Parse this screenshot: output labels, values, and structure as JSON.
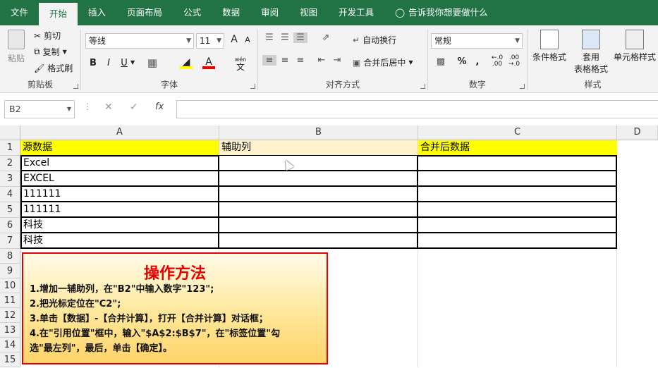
{
  "tabs": [
    "文件",
    "开始",
    "插入",
    "页面布局",
    "公式",
    "数据",
    "审阅",
    "视图",
    "开发工具"
  ],
  "tell_me": "告诉我你想要做什么",
  "ribbon": {
    "clipboard": {
      "paste": "粘贴",
      "cut": "剪切",
      "copy": "复制",
      "format_painter": "格式刷",
      "label": "剪贴板"
    },
    "font": {
      "name": "等线",
      "size": "11",
      "label": "字体",
      "bold": "B",
      "italic": "I",
      "underline": "U",
      "grow": "A",
      "shrink": "A",
      "wen": "wén",
      "phonetic": "文"
    },
    "alignment": {
      "wrap": "自动换行",
      "merge": "合并后居中",
      "label": "对齐方式"
    },
    "number": {
      "format": "常规",
      "percent": "%",
      "comma": ",",
      "label": "数字"
    },
    "styles": {
      "conditional": "条件格式",
      "table_l1": "套用",
      "table_l2": "表格格式",
      "cell_styles": "单元格样式",
      "label": "样式"
    }
  },
  "formula_bar": {
    "name_box": "B2",
    "fx": "fx",
    "value": ""
  },
  "columns": [
    "A",
    "B",
    "C",
    "D"
  ],
  "rows": [
    "1",
    "2",
    "3",
    "4",
    "5",
    "6",
    "7",
    "8",
    "9",
    "10",
    "11",
    "12",
    "13",
    "14",
    "15"
  ],
  "cells": {
    "A1": "源数据",
    "B1": "辅助列",
    "C1": "合并后数据",
    "A2": "Excel",
    "A3": "EXCEL",
    "A4": "111111",
    "A5": "111111",
    "A6": "科技",
    "A7": "科技"
  },
  "note": {
    "title": "操作方法",
    "lines": [
      "1.增加一辅助列，在\"B2\"中输入数字\"123\";",
      "2.把光标定位在\"C2\";",
      "3.单击【数据】-【合并计算】，打开【合并计算】对话框；",
      "4.在\"引用位置\"框中，输入\"$A$2:$B$7\"，在\"标签位置\"勾",
      "选\"最左列\"，最后，单击【确定】。"
    ]
  },
  "colors": {
    "accent": "#217346",
    "header_fill": "#ffff00",
    "note_border": "#e60000"
  }
}
